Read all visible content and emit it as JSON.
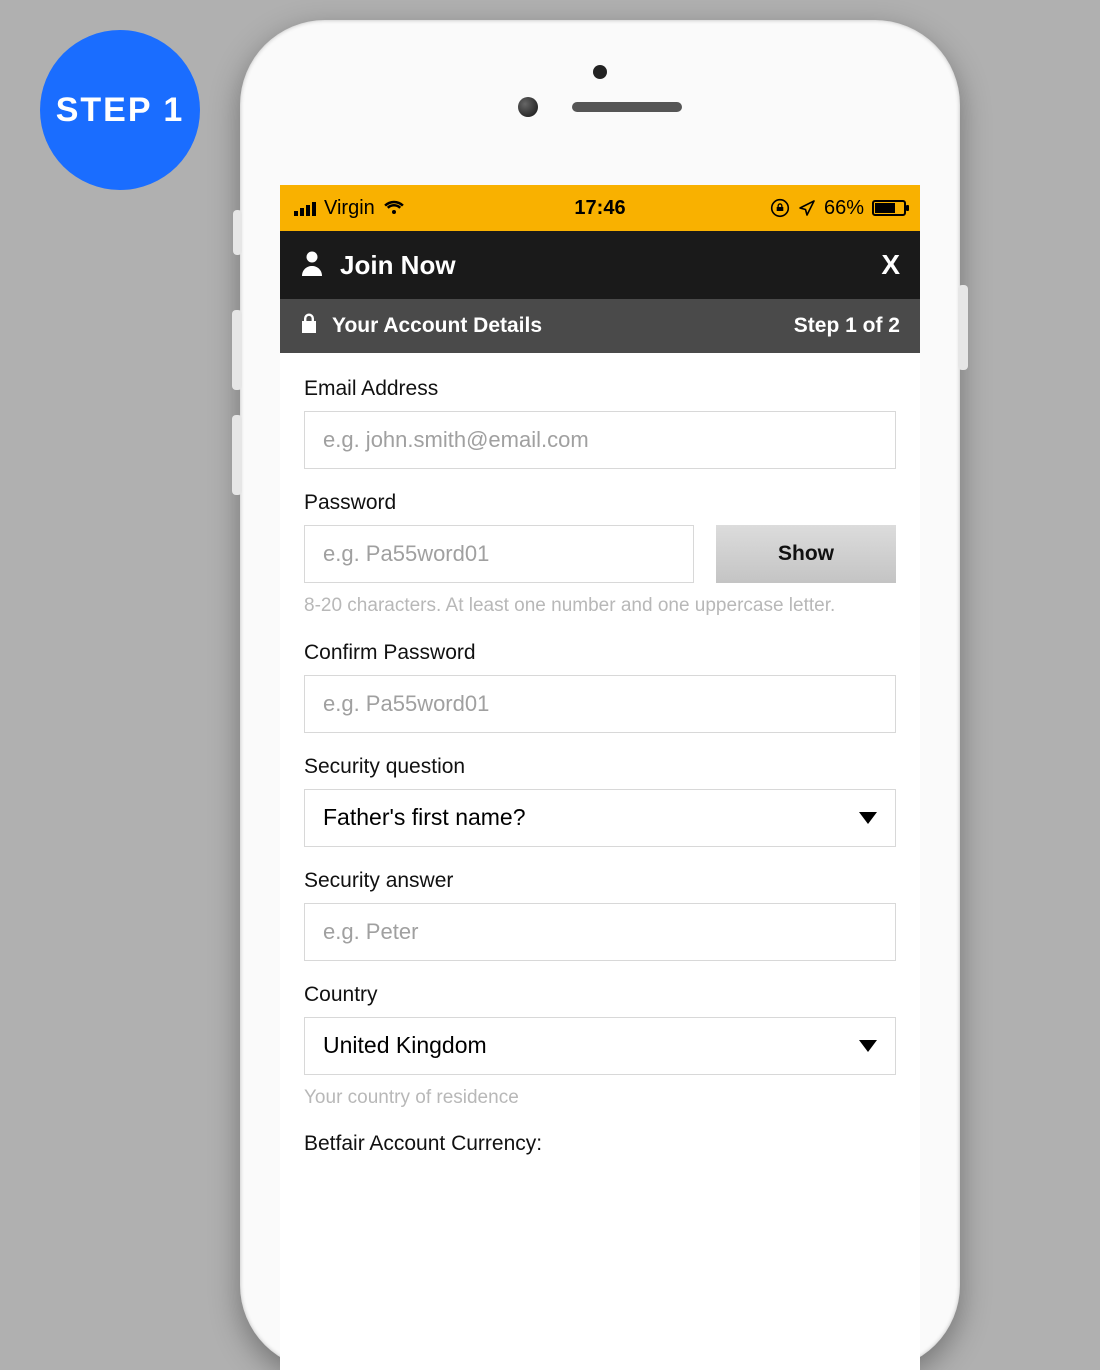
{
  "badge": {
    "label": "STEP 1"
  },
  "status": {
    "carrier": "Virgin",
    "time": "17:46",
    "battery_pct": "66%"
  },
  "header": {
    "title": "Join Now",
    "close": "X"
  },
  "subheader": {
    "title": "Your Account Details",
    "step": "Step 1 of 2"
  },
  "form": {
    "email": {
      "label": "Email Address",
      "placeholder": "e.g. john.smith@email.com"
    },
    "password": {
      "label": "Password",
      "placeholder": "e.g. Pa55word01",
      "show": "Show",
      "hint": "8-20 characters. At least one number and one uppercase letter."
    },
    "confirm": {
      "label": "Confirm Password",
      "placeholder": "e.g. Pa55word01"
    },
    "secq": {
      "label": "Security question",
      "value": "Father's first name?"
    },
    "seca": {
      "label": "Security answer",
      "placeholder": "e.g. Peter"
    },
    "country": {
      "label": "Country",
      "value": "United Kingdom",
      "hint": "Your country of residence"
    },
    "currency": {
      "label": "Betfair Account Currency:"
    }
  }
}
